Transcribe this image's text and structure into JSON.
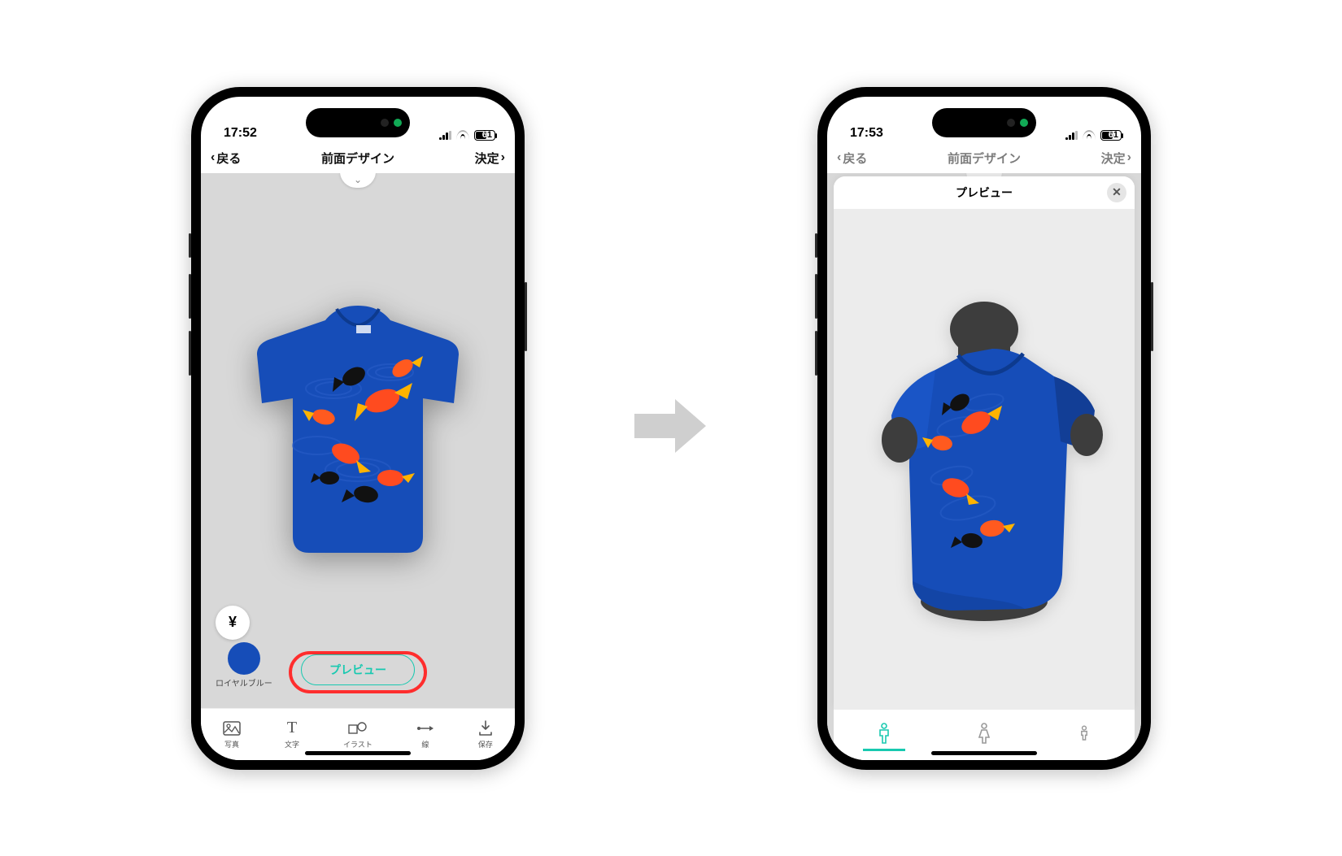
{
  "left": {
    "status_time": "17:52",
    "battery_pct": "61",
    "nav_back": "戻る",
    "nav_title": "前面デザイン",
    "nav_done": "決定",
    "price_symbol": "¥",
    "color_name": "ロイヤルブルー",
    "preview_label": "プレビュー",
    "tools": [
      {
        "label": "写真"
      },
      {
        "label": "文字"
      },
      {
        "label": "イラスト"
      },
      {
        "label": "線"
      },
      {
        "label": "保存"
      }
    ],
    "shirt_color": "#164db8"
  },
  "right": {
    "status_time": "17:53",
    "battery_pct": "61",
    "nav_back": "戻る",
    "nav_title": "前面デザイン",
    "nav_done": "決定",
    "sheet_title": "プレビュー",
    "body_types": [
      "male",
      "female",
      "child"
    ],
    "shirt_color": "#164db8"
  }
}
